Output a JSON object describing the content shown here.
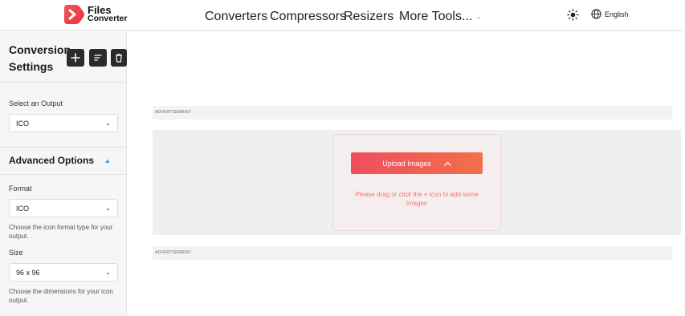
{
  "brand": {
    "line1": "Files",
    "line2": "Converter",
    "accent": "#f04e5d"
  },
  "nav": {
    "items": [
      {
        "label": "Converters"
      },
      {
        "label": "Compressors"
      },
      {
        "label": "Resizers"
      },
      {
        "label": "More Tools..."
      }
    ],
    "chevron": "⌄",
    "language": "English"
  },
  "sidebar": {
    "title": "Conversion Settings",
    "buttons": [
      "plus-icon",
      "sort-icon",
      "trash-icon"
    ],
    "output_label": "Select an Output",
    "output_value": "ICO",
    "advanced_title": "Advanced Options",
    "format_label": "Format",
    "format_value": "ICO",
    "format_help": "Choose the icon format type for your output.",
    "size_label": "Size",
    "size_value": "96 x 96",
    "size_help": "Choose the dimensions for your icon output."
  },
  "main": {
    "ad_label_top": "ADVERTISEMENT",
    "ad_label_bottom": "ADVERTISEMENT",
    "upload_label": "Upload Images",
    "drop_hint": "Please drag or click the + icon to add some images"
  }
}
